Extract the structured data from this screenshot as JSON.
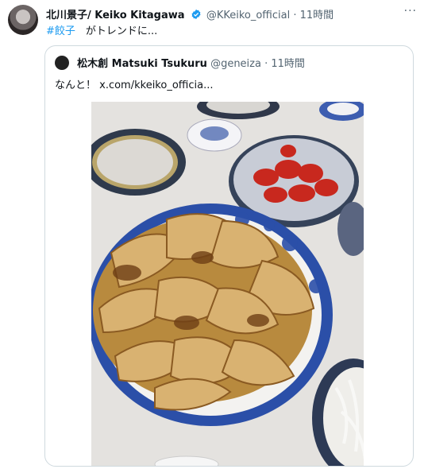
{
  "tweet": {
    "author_name": "北川景子/ Keiko Kitagawa",
    "handle": "@KKeiko_official",
    "separator": "·",
    "time": "11時間",
    "more_label": "···",
    "hashtag": "#餃子",
    "text": "　がトレンドに..."
  },
  "quote": {
    "author_name": "松木創 Matsuki Tsukuru",
    "handle": "@geneiza",
    "separator": "·",
    "time": "11時間",
    "text": "なんと！ x.com/kkeiko_officia..."
  },
  "media": {
    "image_alt": "餃子"
  },
  "colors": {
    "link": "#1d9bf0",
    "secondary_text": "#536471",
    "verified": "#1d9bf0"
  }
}
